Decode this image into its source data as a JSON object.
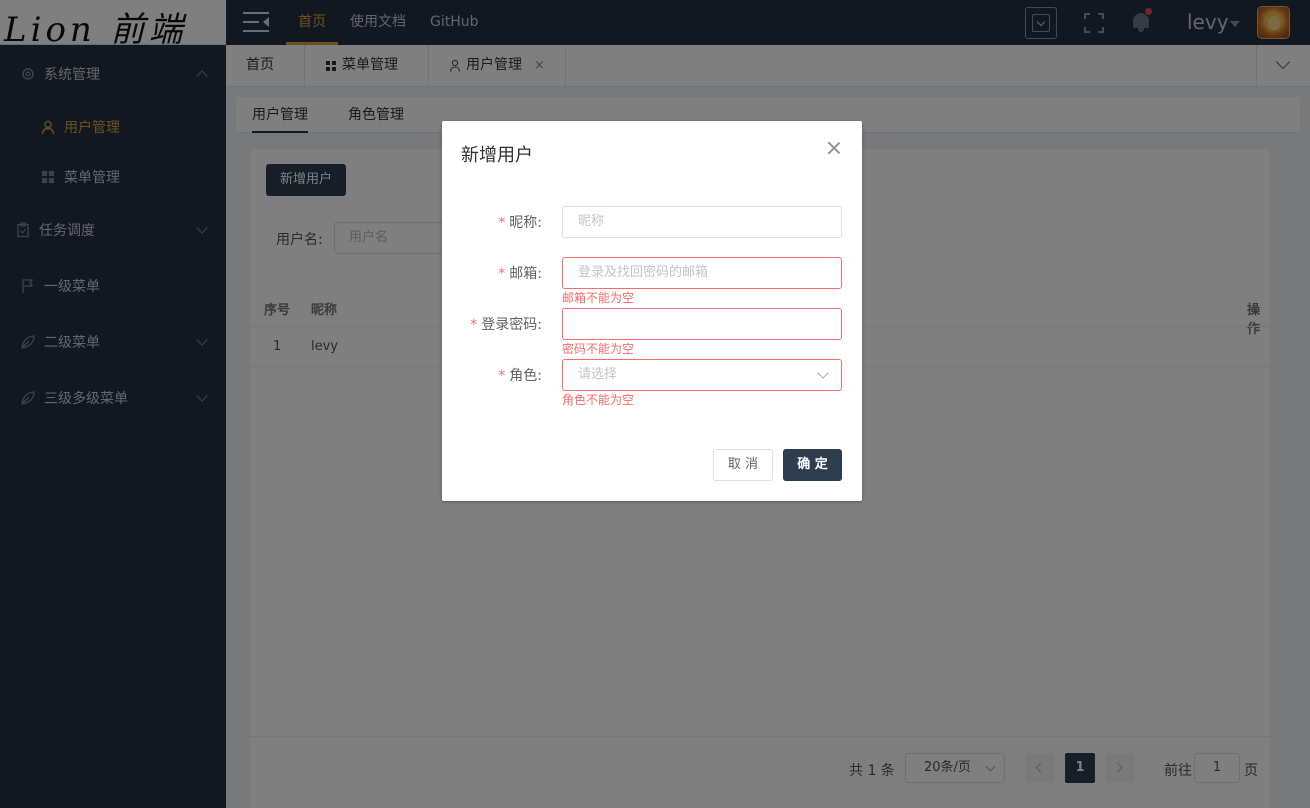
{
  "logo": {
    "text": "Lion 前端"
  },
  "sidebar": {
    "items": [
      {
        "label": "系统管理",
        "icon": "gear-icon"
      },
      {
        "label": "用户管理",
        "icon": "user-icon",
        "active": true
      },
      {
        "label": "菜单管理",
        "icon": "grid-icon"
      },
      {
        "label": "任务调度",
        "icon": "clipboard-icon"
      },
      {
        "label": "一级菜单",
        "icon": "flag-icon"
      },
      {
        "label": "二级菜单",
        "icon": "leaf-icon"
      },
      {
        "label": "三级多级菜单",
        "icon": "leaf-icon"
      }
    ]
  },
  "topbar": {
    "nav": [
      {
        "label": "首页"
      },
      {
        "label": "使用文档"
      },
      {
        "label": "GitHub"
      }
    ],
    "user": "levy",
    "accent_color": "#d8a334"
  },
  "tabs": [
    {
      "label": "首页"
    },
    {
      "label": "菜单管理",
      "icon": "grid-icon"
    },
    {
      "label": "用户管理",
      "icon": "user-icon",
      "close": "×"
    }
  ],
  "subtabs": [
    {
      "label": "用户管理"
    },
    {
      "label": "角色管理"
    }
  ],
  "main": {
    "add_button": "新增用户",
    "search": {
      "label": "用户名:",
      "placeholder": "用户名"
    },
    "table": {
      "headers": {
        "index": "序号",
        "nickname": "昵称",
        "actions": "操作"
      },
      "rows": [
        {
          "index": "1",
          "nickname": "levy"
        }
      ]
    },
    "pagination": {
      "total": "共 1 条",
      "page_size": "20条/页",
      "current_page": "1",
      "goto_label": "前往",
      "goto_value": "1",
      "page_unit": "页"
    }
  },
  "dialog": {
    "title": "新增用户",
    "fields": [
      {
        "label": "昵称:",
        "placeholder": "昵称",
        "error": ""
      },
      {
        "label": "邮箱:",
        "placeholder": "登录及找回密码的邮箱",
        "error": "邮箱不能为空"
      },
      {
        "label": "登录密码:",
        "placeholder": "",
        "error": "密码不能为空"
      },
      {
        "label": "角色:",
        "placeholder": "请选择",
        "error": "角色不能为空"
      }
    ],
    "required_mark": "*",
    "cancel": "取 消",
    "confirm": "确 定"
  }
}
